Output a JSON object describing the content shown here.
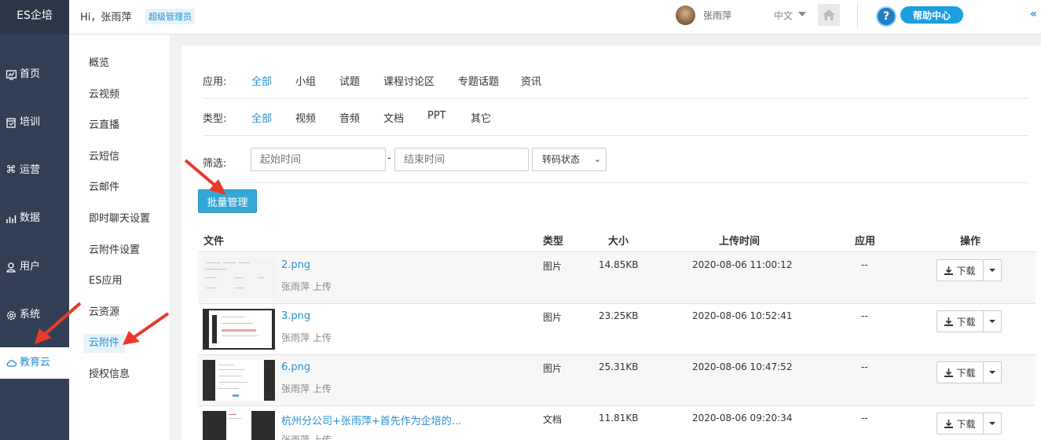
{
  "brand": "ES企培",
  "nav": [
    {
      "label": "首页",
      "icon": "dashboard-icon"
    },
    {
      "label": "培训",
      "icon": "book-icon"
    },
    {
      "label": "运营",
      "icon": "command-icon"
    },
    {
      "label": "数据",
      "icon": "chart-icon"
    },
    {
      "label": "用户",
      "icon": "user-icon"
    },
    {
      "label": "系统",
      "icon": "gear-icon"
    },
    {
      "label": "教育云",
      "icon": "cloud-icon"
    }
  ],
  "header": {
    "greeting": "Hi，张雨萍",
    "role": "超级管理员",
    "username": "张雨萍",
    "language": "中文",
    "help": "帮助中心",
    "help_q": "?",
    "collapse": "«"
  },
  "submenu": [
    "概览",
    "云视频",
    "云直播",
    "云短信",
    "云邮件",
    "即时聊天设置",
    "云附件设置",
    "ES应用",
    "云资源",
    "云附件",
    "授权信息"
  ],
  "filters": {
    "app_label": "应用:",
    "app_options": [
      "全部",
      "小组",
      "试题",
      "课程讨论区",
      "专题话题",
      "资讯"
    ],
    "type_label": "类型:",
    "type_options": [
      "全部",
      "视频",
      "音频",
      "文档",
      "PPT",
      "其它"
    ],
    "screen_label": "筛选:",
    "start_placeholder": "起始时间",
    "end_placeholder": "结束时间",
    "dash": "-",
    "status_select": "转码状态"
  },
  "batch_button": "批量管理",
  "table": {
    "headers": [
      "文件",
      "类型",
      "大小",
      "上传时间",
      "应用",
      "操作"
    ],
    "rows": [
      {
        "name": "2.png",
        "uploader": "张雨萍 上传",
        "type": "图片",
        "size": "14.85KB",
        "time": "2020-08-06 11:00:12",
        "app": "--",
        "action": "下载"
      },
      {
        "name": "3.png",
        "uploader": "张雨萍 上传",
        "type": "图片",
        "size": "23.25KB",
        "time": "2020-08-06 10:52:41",
        "app": "--",
        "action": "下载"
      },
      {
        "name": "6.png",
        "uploader": "张雨萍 上传",
        "type": "图片",
        "size": "25.31KB",
        "time": "2020-08-06 10:47:52",
        "app": "--",
        "action": "下载"
      },
      {
        "name": "杭州分公司+张雨萍+首先作为企培的...",
        "uploader": "张雨萍 上传",
        "type": "文档",
        "size": "11.81KB",
        "time": "2020-08-06 09:20:34",
        "app": "--",
        "action": "下载"
      }
    ]
  },
  "colors": {
    "nav_bg": "#333f55",
    "accent": "#2b8fd0",
    "button": "#35a7d7",
    "annotation": "#e8392a"
  }
}
